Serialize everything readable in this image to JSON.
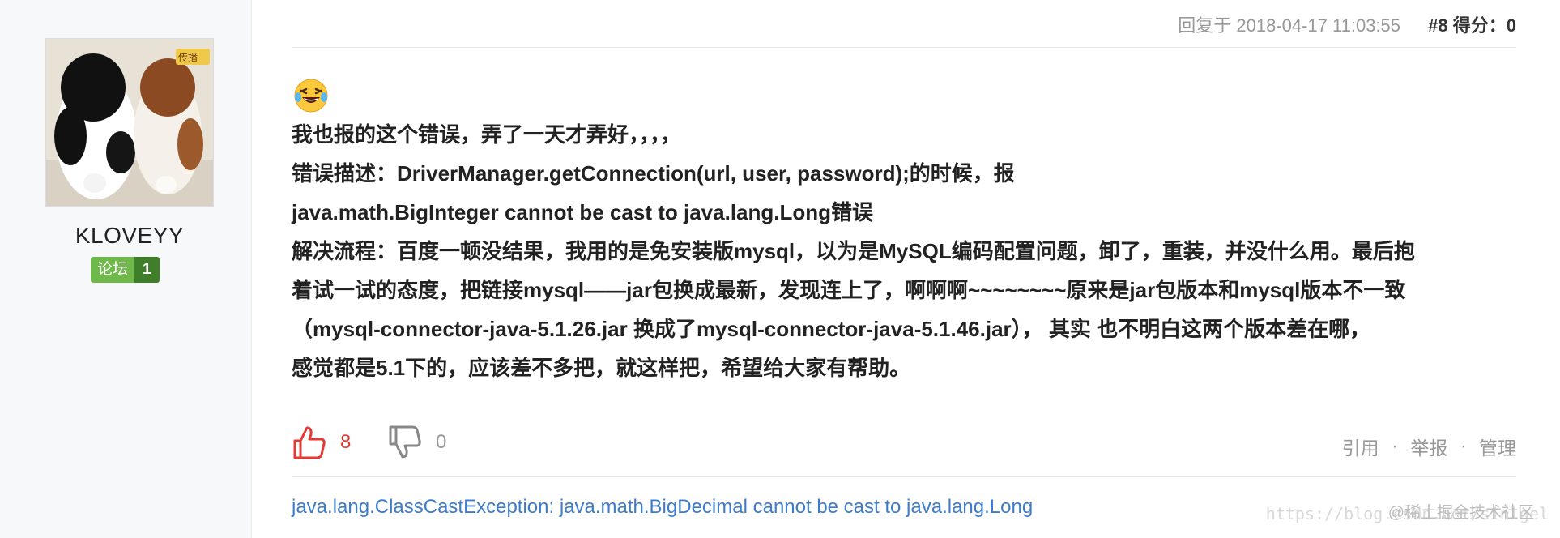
{
  "user": {
    "avatar_icon": "avatar-puppies",
    "username": "KLOVEYY",
    "badge_label": "论坛",
    "badge_level": "1"
  },
  "post": {
    "reply_time": "回复于 2018-04-17 11:03:55",
    "floor": "#8",
    "score_label": "得分：0",
    "emoji": "laughing-tears-emoji",
    "lines": [
      "我也报的这个错误，弄了一天才弄好，，，，",
      "错误描述：DriverManager.getConnection(url, user, password);的时候，报",
      "java.math.BigInteger cannot be cast to java.lang.Long错误",
      "解决流程：百度一顿没结果，我用的是免安装版mysql，以为是MySQL编码配置问题，卸了，重装，并没什么用。最后抱",
      "着试一试的态度，把链接mysql——jar包换成最新，发现连上了，啊啊啊~~~~~~~~原来是jar包版本和mysql版本不一致",
      "（mysql-connector-java-5.1.26.jar 换成了mysql-connector-java-5.1.46.jar）， 其实 也不明白这两个版本差在哪，",
      "感觉都是5.1下的，应该差不多把，就这样把，希望给大家有帮助。"
    ],
    "likes": "8",
    "dislikes": "0",
    "links": {
      "quote": "引用",
      "report": "举报",
      "manage": "管理",
      "separator": "·"
    },
    "related_link": "java.lang.ClassCastException: java.math.BigDecimal cannot be cast to java.lang.Long"
  },
  "watermark": {
    "url": "https://blog.csdn.net/sinlgel",
    "brand": "@稀土掘金技术社区"
  },
  "colors": {
    "like_red": "#e53935",
    "link_blue": "#3d7cc9",
    "badge_green": "#6fb94a",
    "badge_dark_green": "#3f7f2a"
  }
}
